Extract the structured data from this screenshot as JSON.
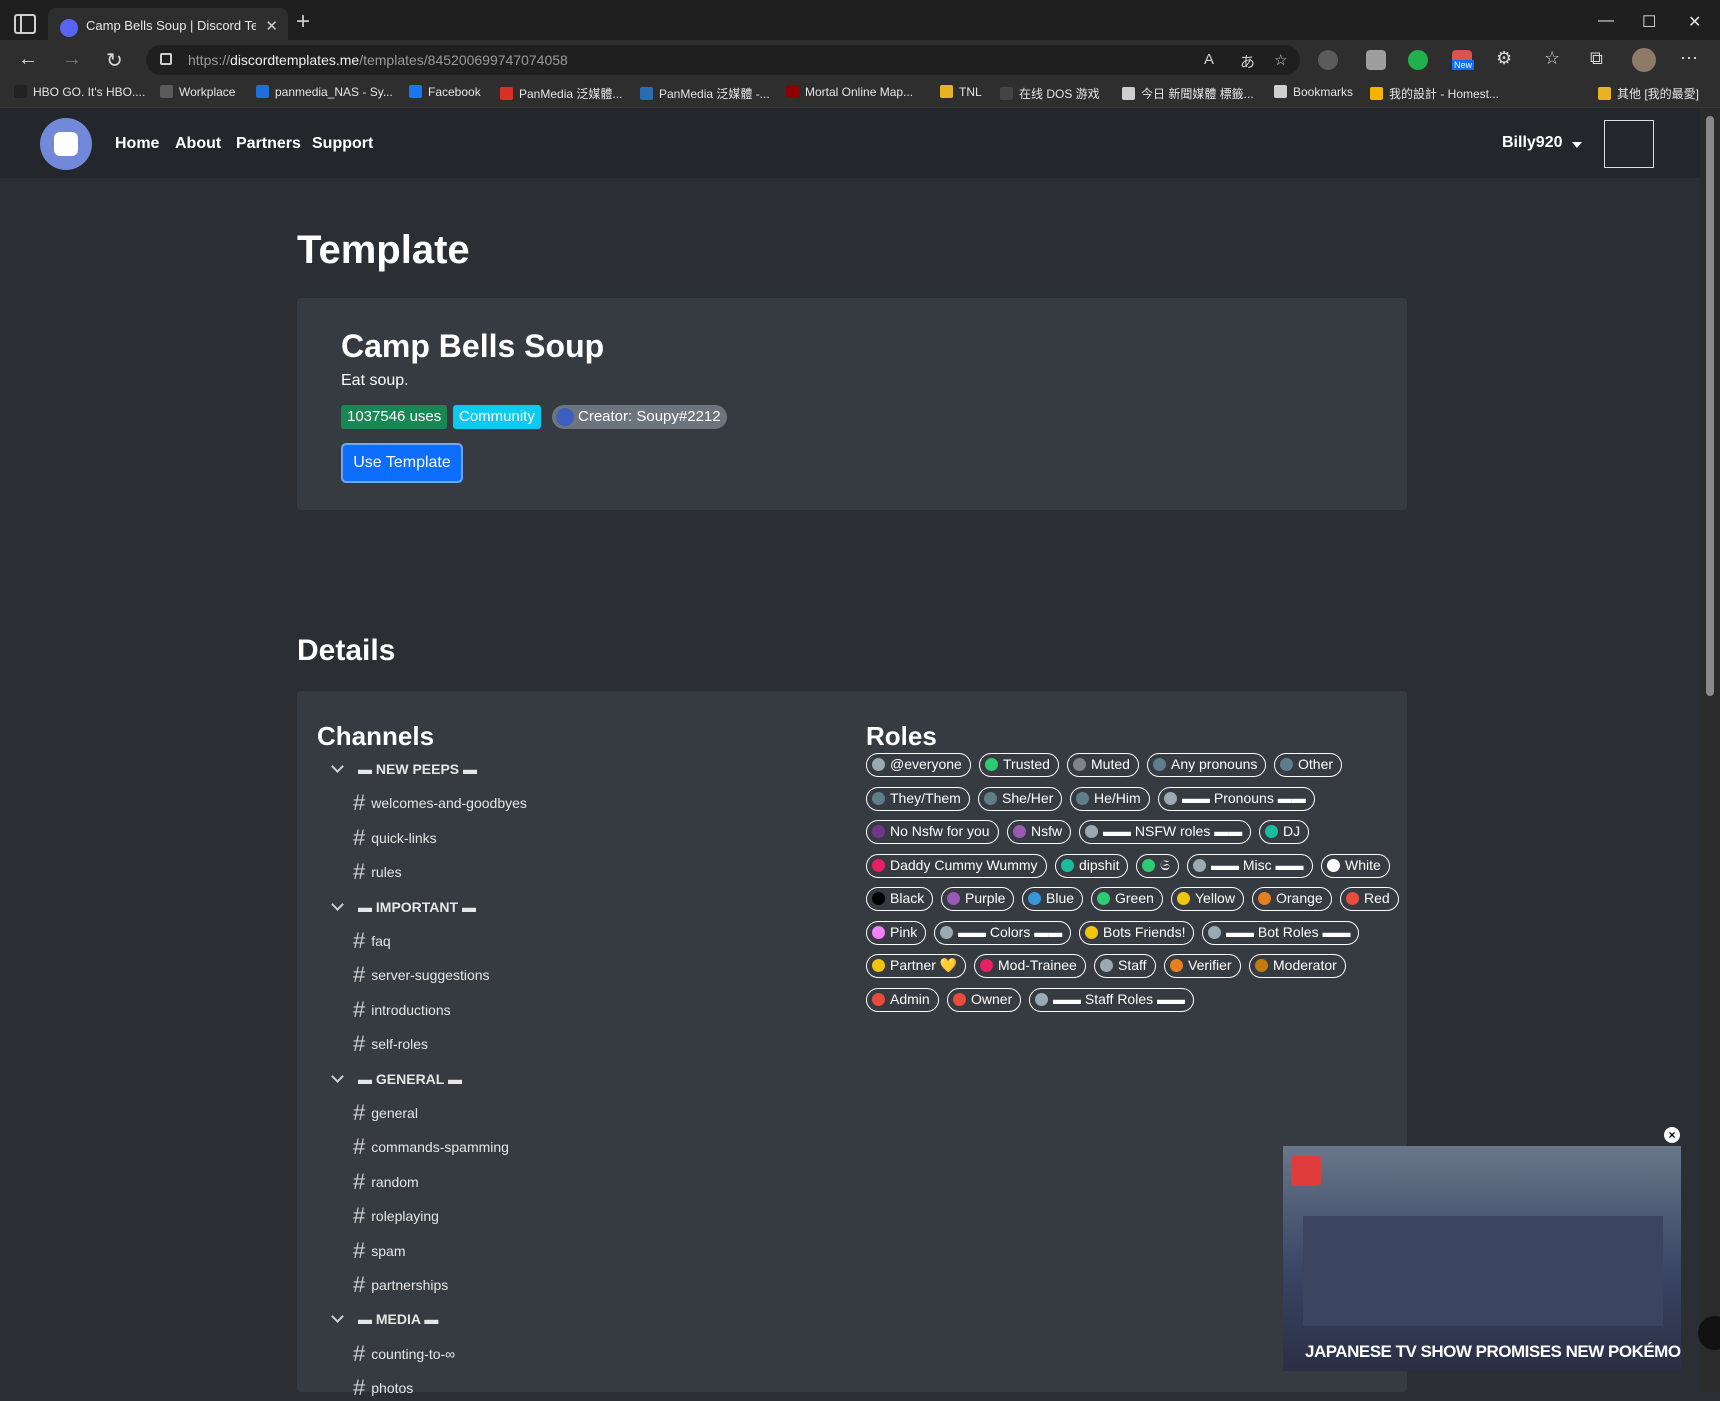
{
  "browser": {
    "tab_title": "Camp Bells Soup | Discord Temp",
    "url_prefix": "https://",
    "url_host": "discordtemplates.me",
    "url_path": "/templates/845200699747074058",
    "ext_new_badge": "New",
    "bookmarks": [
      "HBO GO. It's HBO....",
      "Workplace",
      "panmedia_NAS - Sy...",
      "Facebook",
      "PanMedia 泛媒體...",
      "PanMedia 泛媒體 -...",
      "Mortal Online Map...",
      "TNL",
      "在线 DOS 游戏",
      "今日 新聞媒體 標籤...",
      "Bookmarks",
      "我的設計 - Homest...",
      "其他 [我的最愛]"
    ]
  },
  "nav": {
    "links": [
      "Home",
      "About",
      "Partners",
      "Support"
    ],
    "username": "Billy920"
  },
  "page_title": "Template",
  "template": {
    "name": "Camp Bells Soup",
    "description": "Eat soup.",
    "uses": "1037546 uses",
    "category": "Community",
    "creator": "Creator: Soupy#2212",
    "use_button": "Use Template"
  },
  "details_title": "Details",
  "channels_title": "Channels",
  "roles_title": "Roles",
  "channels": [
    {
      "type": "category",
      "name": "▬ NEW PEEPS ▬"
    },
    {
      "type": "text",
      "name": "welcomes-and-goodbyes"
    },
    {
      "type": "text",
      "name": "quick-links"
    },
    {
      "type": "text",
      "name": "rules"
    },
    {
      "type": "category",
      "name": "▬ IMPORTANT ▬"
    },
    {
      "type": "text",
      "name": "faq"
    },
    {
      "type": "text",
      "name": "server-suggestions"
    },
    {
      "type": "text",
      "name": "introductions"
    },
    {
      "type": "text",
      "name": "self-roles"
    },
    {
      "type": "category",
      "name": "▬ GENERAL ▬"
    },
    {
      "type": "text",
      "name": "general"
    },
    {
      "type": "text",
      "name": "commands-spamming"
    },
    {
      "type": "text",
      "name": "random"
    },
    {
      "type": "text",
      "name": "roleplaying"
    },
    {
      "type": "text",
      "name": "spam"
    },
    {
      "type": "text",
      "name": "partnerships"
    },
    {
      "type": "category",
      "name": "▬ MEDIA ▬"
    },
    {
      "type": "text",
      "name": "counting-to-∞"
    },
    {
      "type": "text",
      "name": "photos"
    }
  ],
  "roles": [
    [
      {
        "name": "@everyone",
        "color": "#99aab5"
      },
      {
        "name": "Trusted",
        "color": "#2ecc71"
      },
      {
        "name": "Muted",
        "color": "#818386"
      },
      {
        "name": "Any pronouns",
        "color": "#607d8b"
      },
      {
        "name": "Other",
        "color": "#607d8b"
      }
    ],
    [
      {
        "name": "They/Them",
        "color": "#607d8b"
      },
      {
        "name": "She/Her",
        "color": "#607d8b"
      },
      {
        "name": "He/Him",
        "color": "#607d8b"
      },
      {
        "name": "▬▬ Pronouns ▬▬",
        "color": "#99aab5"
      }
    ],
    [
      {
        "name": "No Nsfw for you",
        "color": "#71368a"
      },
      {
        "name": "Nsfw",
        "color": "#9b59b6"
      },
      {
        "name": "▬▬ NSFW roles ▬▬",
        "color": "#99aab5"
      },
      {
        "name": "DJ",
        "color": "#1abc9c"
      }
    ],
    [
      {
        "name": "Daddy Cummy Wummy",
        "color": "#e91e63"
      },
      {
        "name": "dipshit",
        "color": "#1abc9c"
      },
      {
        "name": "𝔖",
        "color": "#2ecc71"
      },
      {
        "name": "▬▬ Misc ▬▬",
        "color": "#99aab5"
      },
      {
        "name": "White",
        "color": "#ffffff"
      }
    ],
    [
      {
        "name": "Black",
        "color": "#000000"
      },
      {
        "name": "Purple",
        "color": "#9b59b6"
      },
      {
        "name": "Blue",
        "color": "#3498db"
      },
      {
        "name": "Green",
        "color": "#2ecc71"
      },
      {
        "name": "Yellow",
        "color": "#f1c40f"
      },
      {
        "name": "Orange",
        "color": "#e67e22"
      },
      {
        "name": "Red",
        "color": "#e74c3c"
      }
    ],
    [
      {
        "name": "Pink",
        "color": "#f47fff"
      },
      {
        "name": "▬▬ Colors ▬▬",
        "color": "#99aab5"
      },
      {
        "name": "Bots Friends!",
        "color": "#f1c40f"
      },
      {
        "name": "▬▬ Bot Roles ▬▬",
        "color": "#99aab5"
      }
    ],
    [
      {
        "name": "Partner 💛",
        "color": "#f1c40f"
      },
      {
        "name": "Mod-Trainee",
        "color": "#e91e63"
      },
      {
        "name": "Staff",
        "color": "#99aab5"
      },
      {
        "name": "Verifier",
        "color": "#e67e22"
      },
      {
        "name": "Moderator",
        "color": "#c27c0e"
      }
    ],
    [
      {
        "name": "Admin",
        "color": "#e74c3c"
      },
      {
        "name": "Owner",
        "color": "#e74c3c"
      },
      {
        "name": "▬▬ Staff Roles ▬▬",
        "color": "#99aab5"
      }
    ]
  ],
  "video": {
    "caption": "JAPANESE TV SHOW PROMISES NEW POKÉMON GAME INFO",
    "close": "×"
  },
  "colors": {
    "uses_badge": "#198754",
    "category_badge": "#0dcaf0",
    "creator_badge": "#6c757d",
    "primary": "#0d6efd"
  }
}
